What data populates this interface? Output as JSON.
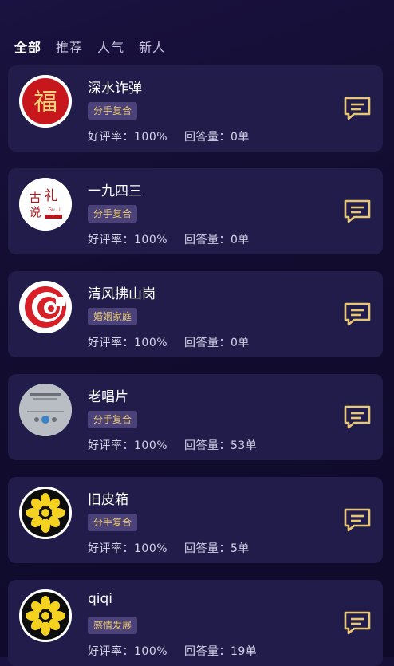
{
  "tabs": [
    "全部",
    "推荐",
    "人气",
    "新人"
  ],
  "stat_labels": {
    "rating": "好评率：",
    "answers": "回答量："
  },
  "experts": [
    {
      "name": "深水诈弹",
      "tag": "分手复合",
      "rating": "100%",
      "answers": "0单",
      "avatar": "fu-seal-icon"
    },
    {
      "name": "一九四三",
      "tag": "分手复合",
      "rating": "100%",
      "answers": "0单",
      "avatar": "guli-logo-icon"
    },
    {
      "name": "清风拂山岗",
      "tag": "婚姻家庭",
      "rating": "100%",
      "answers": "0单",
      "avatar": "red-swirl-icon"
    },
    {
      "name": "老唱片",
      "tag": "分手复合",
      "rating": "100%",
      "answers": "53单",
      "avatar": "music-player-icon"
    },
    {
      "name": "旧皮箱",
      "tag": "分手复合",
      "rating": "100%",
      "answers": "5单",
      "avatar": "yellow-flower-icon"
    },
    {
      "name": "qiqi",
      "tag": "感情发展",
      "rating": "100%",
      "answers": "19单",
      "avatar": "yellow-flower-icon"
    }
  ],
  "avatar_text": {
    "fu": "福",
    "guli1": "古",
    "guli2": "礼",
    "guli3": "说",
    "guli_pinyin": "Gu Li"
  },
  "colors": {
    "accent": "#e8c774",
    "card": "#211c4a",
    "tag_bg": "#4a4278"
  }
}
